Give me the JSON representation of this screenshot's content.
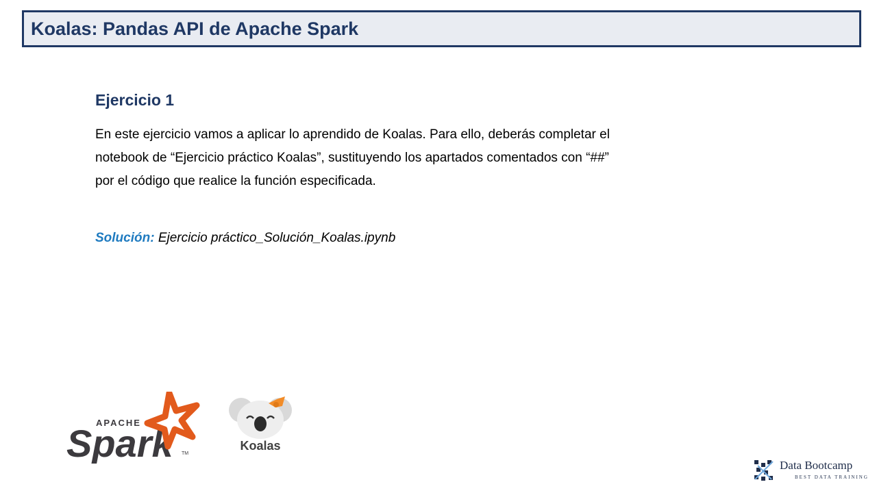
{
  "slide": {
    "title": "Koalas: Pandas API de Apache Spark",
    "heading": "Ejercicio 1",
    "body_lines": [
      "En este ejercicio vamos a aplicar lo aprendido de Koalas. Para  ello, deberás completar el",
      "notebook de  “Ejercicio práctico Koalas”, sustituyendo los apartados comentados con “##”",
      "por el código que realice la función especificada."
    ],
    "solution_label": "Solución:",
    "solution_file": " Ejercicio práctico_Solución_Koalas.ipynb"
  },
  "logos": {
    "spark_small": "APACHE",
    "spark_big": "Spark",
    "spark_tm": "TM",
    "koalas": "Koalas",
    "brand_name": "Data Bootcamp",
    "brand_tagline": "BEST DATA TRAINING"
  },
  "colors": {
    "title_blue": "#1f3864",
    "solution_blue": "#1f7bc0",
    "spark_orange": "#e25a1c",
    "koala_bow": "#f28c28"
  }
}
